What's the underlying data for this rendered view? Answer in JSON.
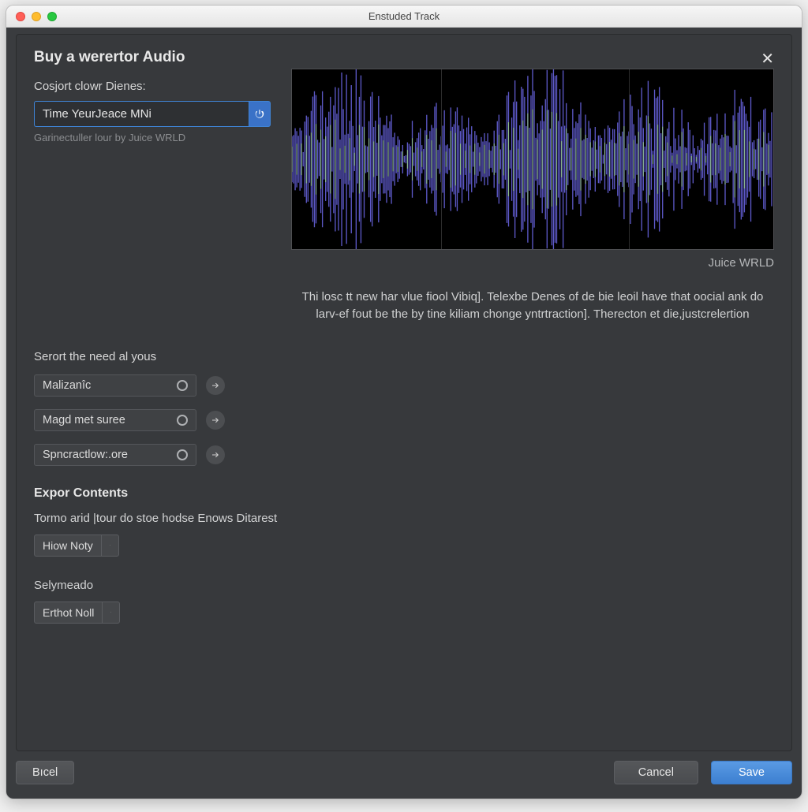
{
  "window": {
    "title": "Enstuded Track"
  },
  "header": {
    "title": "Buy a werertor Audio"
  },
  "search": {
    "label": "Cosjort clowr Dienes:",
    "value": "Time YeurJeace MNi",
    "helper": "Garinectuller lour by  Juice WRLD"
  },
  "waveform": {
    "artist": "Juice WRLD"
  },
  "description": "Thi losc tt new har vlue fiool Vibiq]. Telexbe Denes of de bie leoil have that oocial ank do larv-ef fout be the by tine kiliam chonge yntrtraction]. Therecton et die,justcrelertion",
  "options": {
    "label": "Serort the need al yous",
    "items": [
      {
        "label": "Malizanîc"
      },
      {
        "label": "Magd met suree"
      },
      {
        "label": "Spncractlow:.ore"
      }
    ]
  },
  "export": {
    "heading": "Expor Contents",
    "prompt": "Tormo arid |tour do stoe hodse Enows Ditarest",
    "dropdown1": "Hiow Noty",
    "subheading": "Selymeado",
    "dropdown2": "Erthot Noll"
  },
  "footer": {
    "back": "Bıcel",
    "cancel": "Cancel",
    "save": "Save"
  }
}
